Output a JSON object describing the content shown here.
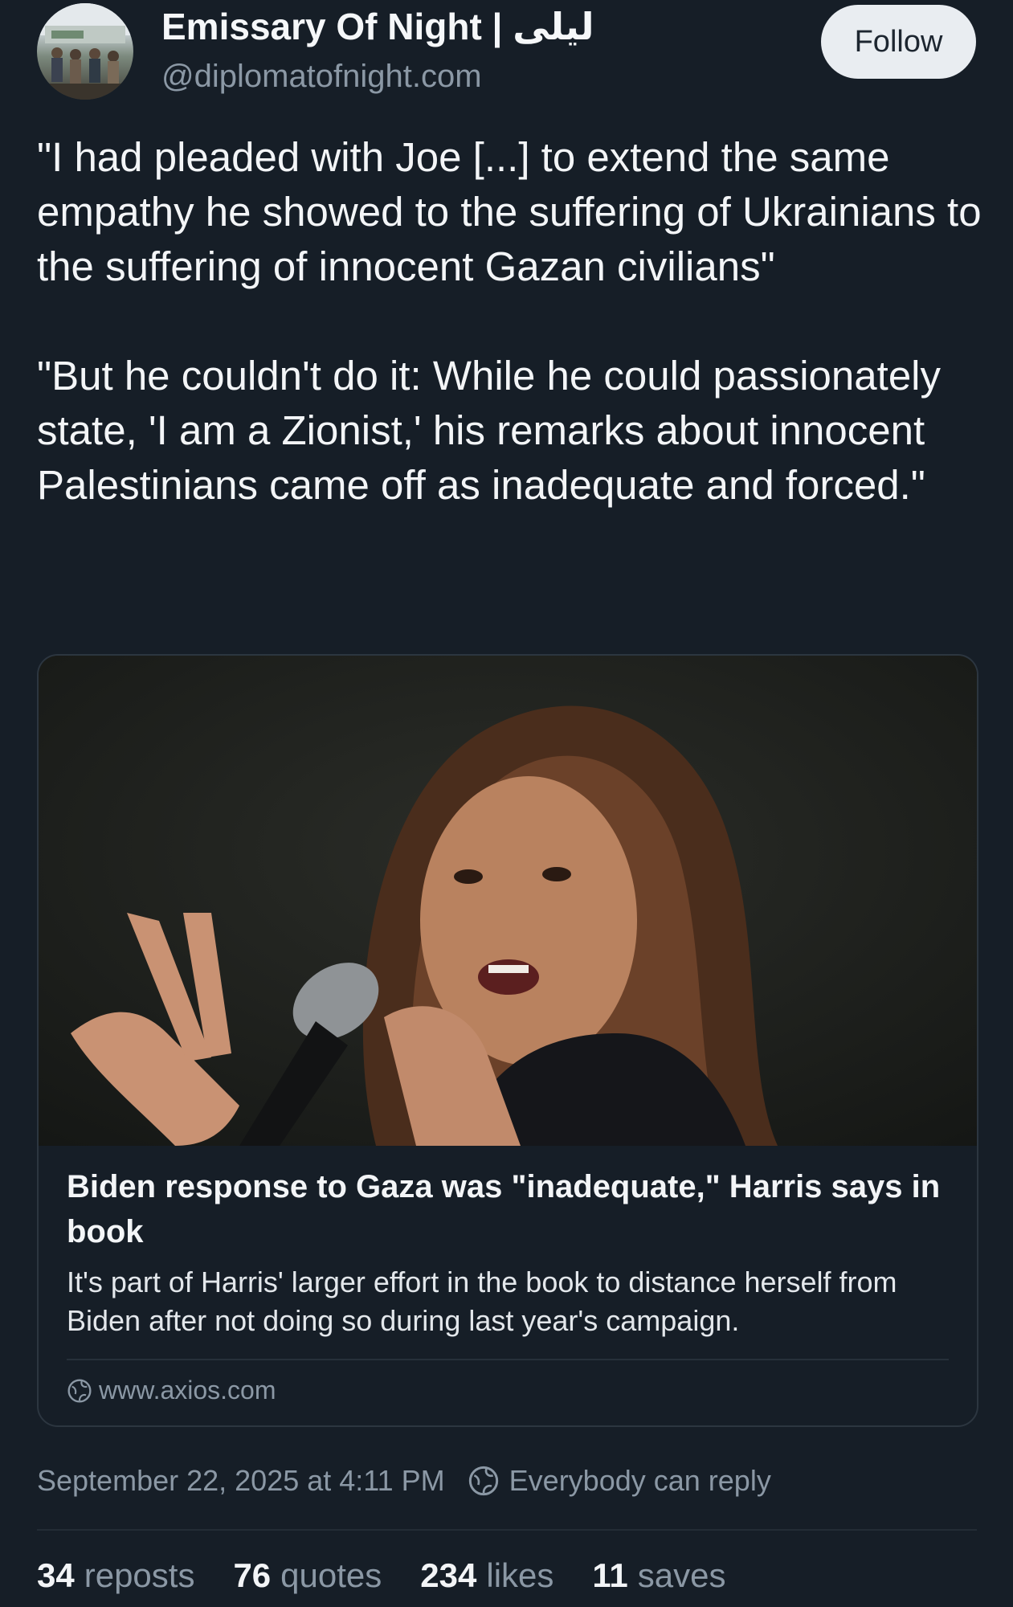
{
  "author": {
    "name": "Emissary Of Night | ليلى",
    "handle": "@diplomatofnight.com",
    "follow_label": "Follow"
  },
  "post": {
    "paragraphs": [
      "\"I had pleaded with Joe [...] to extend the same empathy he showed to the suffering of Ukrainians to the suffering of innocent Gazan civilians\"",
      "\"But he couldn't do it: While he could passionately state, 'I am a Zionist,' his remarks about innocent Palestinians came off as inadequate and forced.\""
    ]
  },
  "link_card": {
    "title": "Biden response to Gaza was \"inadequate,\" Harris says in book",
    "description": "It's part of Harris' larger effort in the book to distance herself from Biden after not doing so during last year's campaign.",
    "domain": "www.axios.com",
    "domain_icon": "globe-icon"
  },
  "meta": {
    "timestamp": "September 22, 2025 at 4:11 PM",
    "reply_setting": "Everybody can reply",
    "reply_icon": "globe-icon"
  },
  "stats": {
    "reposts": {
      "count": "34",
      "label": "reposts"
    },
    "quotes": {
      "count": "76",
      "label": "quotes"
    },
    "likes": {
      "count": "234",
      "label": "likes"
    },
    "saves": {
      "count": "11",
      "label": "saves"
    }
  },
  "colors": {
    "background": "#161e27",
    "text": "#f3f5f7",
    "muted": "#8b98a5",
    "follow_button": "#e9edf1"
  }
}
